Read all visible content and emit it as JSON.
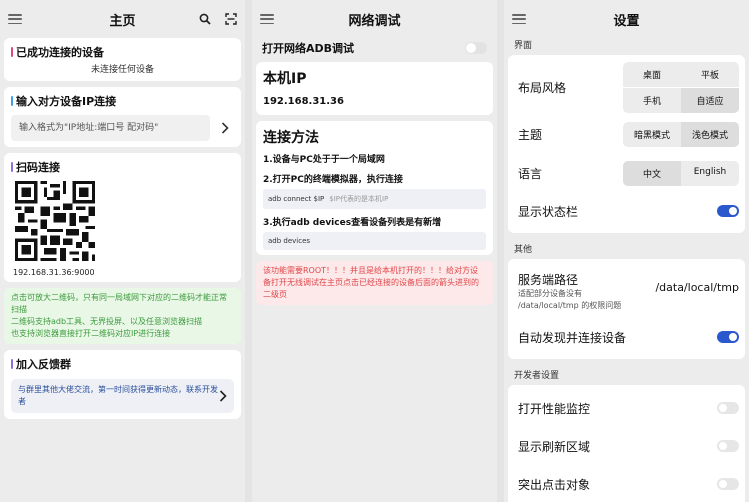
{
  "home": {
    "title": "主页",
    "connected_title": "已成功连接的设备",
    "connected_sub": "未连接任何设备",
    "ip_title": "输入对方设备IP连接",
    "ip_placeholder": "输入格式为\"IP地址:端口号 配对码\"",
    "scan_title": "扫码连接",
    "qr_caption": "192.168.31.36:9000",
    "scan_note": "点击可放大二维码，只有同一局域网下对应的二维码才能正常扫描\n二维码支持adb工具、无界投屏、以及任意浏览器扫描\n也支持浏览器直接打开二维码对应IP进行连接",
    "feedback_title": "加入反馈群",
    "feedback_text": "与群里其他大佬交流，第一时间获得更新动态，联系开发者"
  },
  "adb": {
    "title": "网络调试",
    "toggle_label": "打开网络ADB调试",
    "local_title": "本机IP",
    "local_ip": "192.168.31.36",
    "method_title": "连接方法",
    "step1": "1.设备与PC处于于一个局域网",
    "step2": "2.打开PC的终端模拟器，执行连接",
    "cmd1": "adb connect $IP",
    "cmd1_hint": "$IP代表的是本机IP",
    "step3": "3.执行adb devices查看设备列表是有新增",
    "cmd2": "adb devices",
    "warning": "该功能需要ROOT！！！并且是给本机打开的！！！给对方设备打开无线调试在主页点击已经连接的设备后面的箭头进到的二级页"
  },
  "settings": {
    "title": "设置",
    "group_ui": "界面",
    "layout_label": "布局风格",
    "layout_options": [
      "桌面",
      "平板",
      "手机",
      "自适应"
    ],
    "theme_label": "主题",
    "theme_options": [
      "暗黑模式",
      "浅色模式"
    ],
    "lang_label": "语言",
    "lang_options": [
      "中文",
      "English"
    ],
    "statusbar_label": "显示状态栏",
    "group_other": "其他",
    "server_label": "服务端路径",
    "server_desc": "适配部分设备没有\n/data/local/tmp 的权限问题",
    "server_value": "/data/local/tmp",
    "auto_label": "自动发现并连接设备",
    "group_dev": "开发者设置",
    "perf_label": "打开性能监控",
    "refresh_label": "显示刷新区域",
    "touch_label": "突出点击对象"
  },
  "colors": {
    "accent": "#2b58cc",
    "pink": "#e0487a",
    "blue": "#3aa0e8",
    "purple": "#8f6fd8",
    "green_text": "#3c9b3c",
    "red_text": "#e0484a"
  },
  "icons": [
    "menu-icon",
    "search-icon",
    "scan-icon",
    "chevron-right-icon"
  ]
}
